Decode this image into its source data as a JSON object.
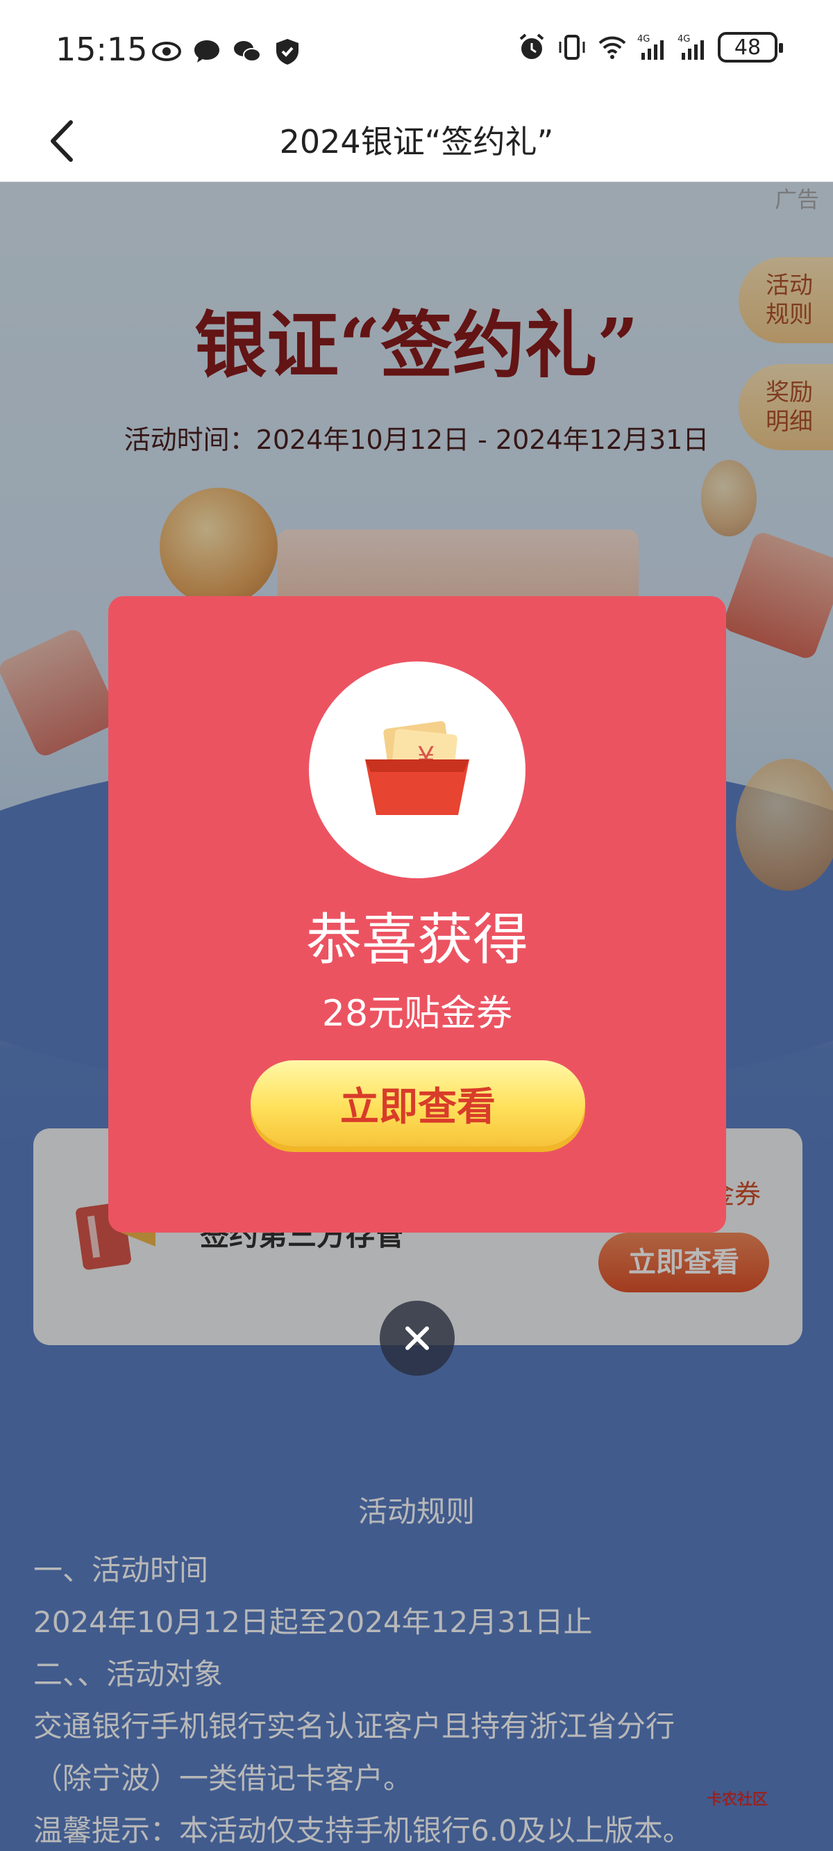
{
  "status_bar": {
    "time": "15:15",
    "battery": "48",
    "signal_label_1": "4G",
    "signal_label_2": "4G"
  },
  "nav": {
    "title": "2024银证“签约礼”",
    "back_icon": "chevron-left-icon"
  },
  "hero": {
    "ad_tag": "广告",
    "title": "银证“签约礼”",
    "date": "活动时间：2024年10月12日 - 2024年12月31日",
    "side_buttons": [
      {
        "line1": "活动",
        "line2": "规则"
      },
      {
        "line1": "奖励",
        "line2": "明细"
      }
    ]
  },
  "card": {
    "text": "签约第三方存管",
    "coupon_text": "金券",
    "button": "立即查看"
  },
  "rules": {
    "heading": "活动规则",
    "lines": [
      "一、活动时间",
      "2024年10月12日起至2024年12月31日止",
      "二、、活动对象",
      "交通银行手机银行实名认证客户且持有浙江省分行",
      "（除宁波）一类借记卡客户。",
      "温馨提示：本活动仅支持手机银行6.0及以上版本。"
    ]
  },
  "modal": {
    "title": "恭喜获得",
    "subtitle": "28元贴金券",
    "button": "立即查看",
    "close_icon": "close-icon"
  },
  "watermark": "卡农社区"
}
